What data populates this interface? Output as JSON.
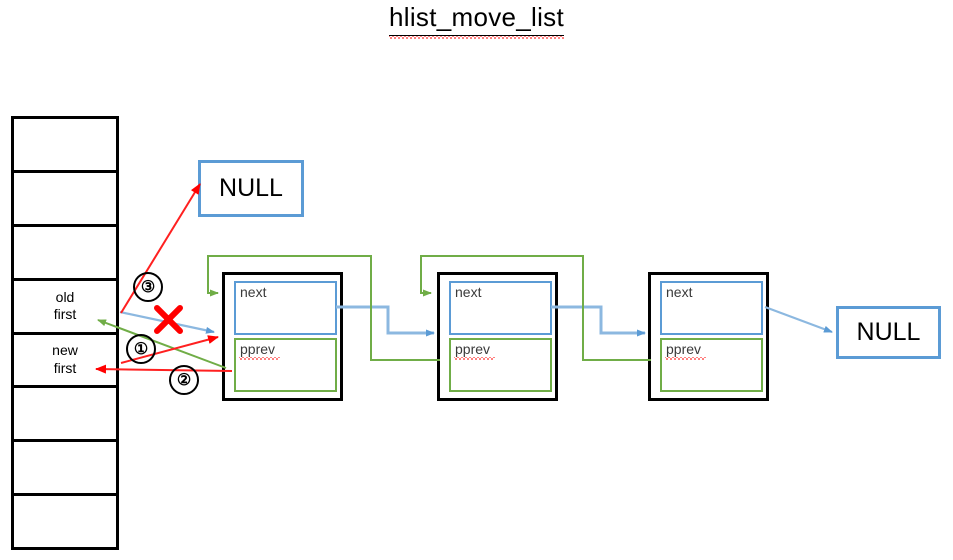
{
  "title": "hlist_move_list",
  "colors": {
    "next_border": "#5b9bd5",
    "pprev_border": "#70ad47",
    "node_border": "#000000",
    "red_arrow": "#ff0000",
    "blue_arrow": "#5b9bd5",
    "green_arrow": "#70ad47",
    "cross_mark": "#ff0000"
  },
  "bucket_table": {
    "name": "hash-bucket-table",
    "cells": [
      {
        "lines": []
      },
      {
        "lines": []
      },
      {
        "lines": []
      },
      {
        "lines": [
          "old",
          "first"
        ]
      },
      {
        "lines": [
          "new",
          "first"
        ]
      },
      {
        "lines": []
      },
      {
        "lines": []
      },
      {
        "lines": []
      }
    ]
  },
  "nodes": [
    {
      "id": "node-1",
      "next_label": "next",
      "pprev_label": "pprev"
    },
    {
      "id": "node-2",
      "next_label": "next",
      "pprev_label": "pprev"
    },
    {
      "id": "node-3",
      "next_label": "next",
      "pprev_label": "pprev"
    }
  ],
  "null_boxes": {
    "top": "NULL",
    "right": "NULL"
  },
  "steps": [
    {
      "id": "step-1",
      "label": "①"
    },
    {
      "id": "step-2",
      "label": "②"
    },
    {
      "id": "step-3",
      "label": "③"
    }
  ],
  "annotations": {
    "cross_mark": "✕"
  }
}
